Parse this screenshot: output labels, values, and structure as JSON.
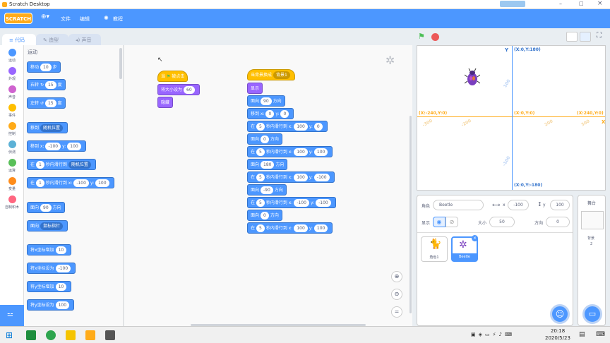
{
  "window": {
    "title": "Scratch Desktop"
  },
  "menu": {
    "logo": "SCRATCH",
    "file": "文件",
    "edit": "编辑",
    "tutorial": "教程"
  },
  "tabs": {
    "code": "代码",
    "costumes": "造型",
    "sounds": "声音"
  },
  "categories": [
    {
      "label": "运动",
      "color": "#4c97ff"
    },
    {
      "label": "外观",
      "color": "#9966ff"
    },
    {
      "label": "声音",
      "color": "#cf63cf"
    },
    {
      "label": "事件",
      "color": "#ffbf00"
    },
    {
      "label": "控制",
      "color": "#ffab19"
    },
    {
      "label": "侦测",
      "color": "#5cb1d6"
    },
    {
      "label": "运算",
      "color": "#59c059"
    },
    {
      "label": "变量",
      "color": "#ff8c1a"
    },
    {
      "label": "自制积木",
      "color": "#ff6680"
    }
  ],
  "palette": {
    "section": "运动",
    "move": "移动",
    "move_val": "10",
    "move_unit": "步",
    "turn_right": "右转",
    "turn_right_val": "15",
    "deg": "度",
    "turn_left": "左转",
    "turn_left_val": "15",
    "goto": "移到",
    "goto_dd": "随机位置",
    "goto_xy": "移到 x:",
    "x_val": "-100",
    "y": "y:",
    "y_val": "100",
    "glide_a": "在",
    "glide_sec": "1",
    "glide_b": "秒内滑行到",
    "glide_dd": "随机位置",
    "glide_xy_b": "秒内滑行到 x:",
    "glide_x": "-100",
    "glide_y": "100",
    "point": "面向",
    "point_val": "90",
    "point_unit": "方向",
    "point_to": "面向",
    "point_to_dd": "鼠标指针",
    "change_x": "将x坐标增加",
    "change_x_val": "10",
    "set_x": "将x坐标设为",
    "set_x_val": "-100",
    "change_y": "将y坐标增加",
    "change_y_val": "10",
    "set_y": "将y坐标设为",
    "set_y_val": "100"
  },
  "script1": {
    "hat": "当",
    "hat_b": "被点击",
    "size": "将大小设为",
    "size_val": "60",
    "hide": "隐藏"
  },
  "script2": {
    "hat": "当背景换成",
    "hat_dd": "背景1",
    "show": "显示",
    "dir": "面向",
    "dir_val": "90",
    "dir_unit": "方向",
    "goto": "移到 x:",
    "gx": "0",
    "gy_l": "y:",
    "gy": "0",
    "glides": [
      {
        "a": "在",
        "s": "5",
        "b": "秒内滑行到 x:",
        "x": "100",
        "yl": "y:",
        "y": "0"
      },
      {
        "dir": "0"
      },
      {
        "a": "在",
        "s": "5",
        "b": "秒内滑行到 x:",
        "x": "100",
        "yl": "y:",
        "y": "100"
      },
      {
        "dir": "180"
      },
      {
        "a": "在",
        "s": "5",
        "b": "秒内滑行到 x:",
        "x": "100",
        "yl": "y:",
        "y": "-100"
      },
      {
        "dir": "-90"
      },
      {
        "a": "在",
        "s": "5",
        "b": "秒内滑行到 x:",
        "x": "-100",
        "yl": "y:",
        "y": "-100"
      },
      {
        "dir": "0"
      },
      {
        "a": "在",
        "s": "5",
        "b": "秒内滑行到 x:",
        "x": "100",
        "yl": "y:",
        "y": "100"
      }
    ]
  },
  "stage": {
    "y_axis": "Y",
    "top": "(X:0,Y:180)",
    "left": "(X:-240,Y:0)",
    "origin": "(X:0,Y:0)",
    "right": "(X:240,Y:0)",
    "x_axis": "X",
    "bottom": "(X:0,Y:-180)",
    "tick_p100": "100",
    "tick_n100": "-100",
    "tick_p200": "200",
    "tick_n200": "-200",
    "tick_n300": "-300",
    "tick_p300": "300"
  },
  "sprite_info": {
    "sprite_label": "角色",
    "sprite_name": "Beetle",
    "x_label": "x",
    "x": "-100",
    "y_label": "y",
    "y": "100",
    "show_label": "显示",
    "size_label": "大小",
    "size": "50",
    "dir_label": "方向",
    "dir": "0"
  },
  "sprites": [
    {
      "name": "角色1"
    },
    {
      "name": "Beetle"
    }
  ],
  "stage_panel": {
    "title": "舞台",
    "backdrop_label": "背景",
    "backdrop_count": "2"
  },
  "taskbar": {
    "time": "20:18",
    "date": "2020/5/23"
  }
}
